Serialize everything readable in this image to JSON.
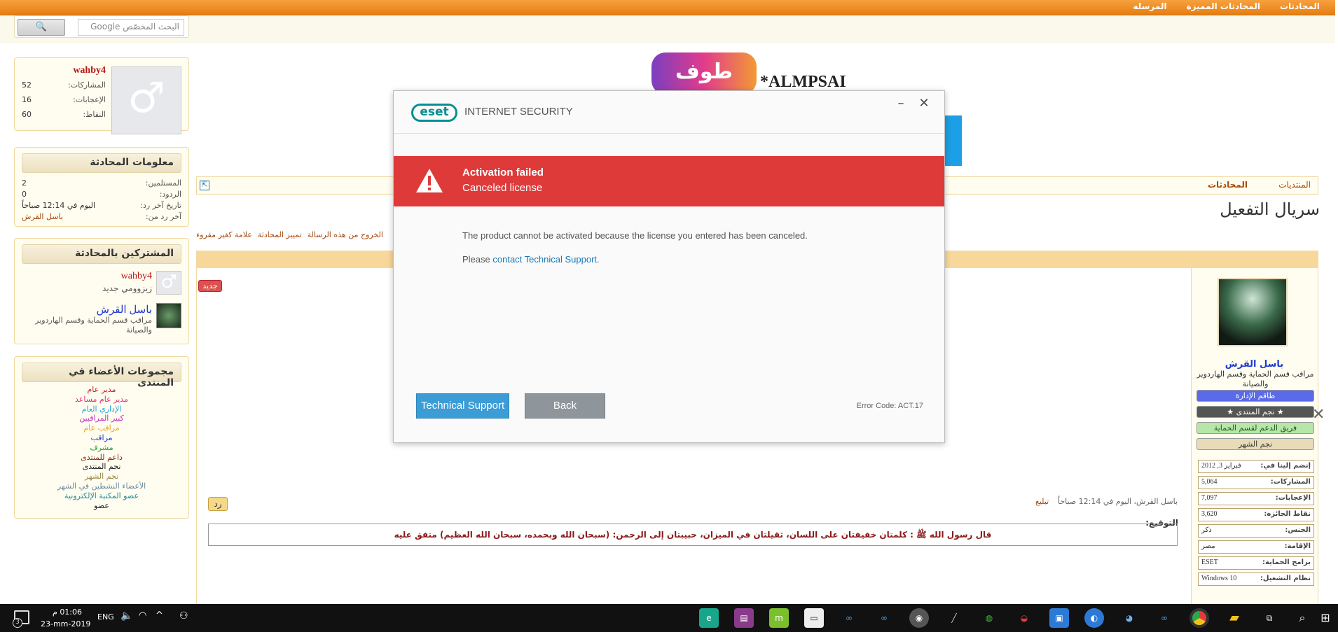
{
  "topnav": [
    "المحادثات",
    "المحادثات المميزة",
    "المرسله"
  ],
  "search": {
    "placeholder": "البحث المخصّص Google",
    "button": "🔍"
  },
  "header_logo": {
    "text": "طوف",
    "latin": "*ALMPSAI"
  },
  "user_panel": {
    "name": "wahby4",
    "rows": [
      {
        "label": "المشاركات:",
        "value": "52"
      },
      {
        "label": "الإعجابات:",
        "value": "16"
      },
      {
        "label": "النقاط:",
        "value": "60"
      }
    ]
  },
  "conv_info": {
    "title": "معلومات المحادثة",
    "rows": [
      {
        "label": "المستلمين:",
        "value": "2"
      },
      {
        "label": "الردود:",
        "value": "0"
      },
      {
        "label": "تاريخ آخر رد:",
        "value": "اليوم في 12:14 صباحاً"
      },
      {
        "label": "آخر رد من:",
        "value": "باسل القرش"
      }
    ]
  },
  "participants": {
    "title": "المشتركين بالمحادثة",
    "items": [
      {
        "name": "wahby4",
        "role": "زيزوومي جديد"
      },
      {
        "name": "باسل القرش",
        "role": "مراقب قسم الحماية وقسم الهاردوير والصيانة"
      }
    ]
  },
  "groups": {
    "title": "مجموعات الأعضاء في المنتدى",
    "items": [
      {
        "name": "مدير عام",
        "color": "#d21d1d"
      },
      {
        "name": "مدير عام مساعد",
        "color": "#e52c7c"
      },
      {
        "name": "الإداري العام",
        "color": "#1fa3e6"
      },
      {
        "name": "كبير المراقبين",
        "color": "#c12cc1"
      },
      {
        "name": "مراقب عام",
        "color": "#e6a51f"
      },
      {
        "name": "مراقب",
        "color": "#1d3ad2"
      },
      {
        "name": "مشرف",
        "color": "#2c9c2c"
      },
      {
        "name": "داعم للمنتدى",
        "color": "#8a2a0a"
      },
      {
        "name": "نجم المنتدى",
        "color": "#222222"
      },
      {
        "name": "نجم الشهر",
        "color": "#9a8a4a"
      },
      {
        "name": "الأعضاء النشطين في الشهر",
        "color": "#6a8aa0"
      },
      {
        "name": "عضو المكتبة الإلكترونية",
        "color": "#1f8a9c"
      },
      {
        "name": "عضو",
        "color": "#222222"
      }
    ]
  },
  "breadcrumb": [
    "المنتديات",
    "المحادثات"
  ],
  "page_title": "سريال التفعيل",
  "actions": [
    "الخروج من هذه الرسالة",
    "تمييز المحادثة",
    "علامة كغير مقروء"
  ],
  "new_badge": "جديد",
  "reply_btn": "رد",
  "post_meta": {
    "author_time": "باسل القرش، اليوم في 12:14 صباحاً",
    "report": "تبليغ"
  },
  "signature": {
    "label": "التوقيع:",
    "text": "قال رسول الله ﷺ : كلمتان خفيفتان على اللسان، ثقيلتان في الميزان، حبيبتان إلى الرحمن: (سبحان الله وبحمده، سبحان الله العظيم) متفق عليه"
  },
  "poster": {
    "name": "باسل القرش",
    "role": "مراقب قسم الحماية وقسم الهاردوير والصيانة",
    "badges": [
      {
        "text": "طاقم الإدارة",
        "bg": "#5a6ae8",
        "fg": "#ffffff"
      },
      {
        "text": "★ نجم المنتدى ★",
        "bg": "#555555",
        "fg": "#ffffff"
      },
      {
        "text": "فريق الدعم لقسم الحماية",
        "bg": "#b6e6a8",
        "fg": "#1c5a1c"
      },
      {
        "text": "نجم الشهر",
        "bg": "#e8dcb8",
        "fg": "#333333"
      }
    ],
    "info": [
      {
        "label": "إنضم إلينا في:",
        "value": "فبراير 3, 2012"
      },
      {
        "label": "المشاركات:",
        "value": "5,064"
      },
      {
        "label": "الإعجابات:",
        "value": "7,097"
      },
      {
        "label": "نقاط الجائزة:",
        "value": "3,620"
      },
      {
        "label": "الجنس:",
        "value": "ذكر"
      },
      {
        "label": "الإقامة:",
        "value": "مصر"
      },
      {
        "label": "برامج الحماية:",
        "value": "ESET"
      },
      {
        "label": "نظام التشغيل:",
        "value": "Windows 10"
      }
    ]
  },
  "modal": {
    "logo": "eset",
    "product": "INTERNET SECURITY",
    "alert_title": "Activation failed",
    "alert_sub": "Canceled license",
    "message": "The product cannot be activated because the license you entered has been canceled.",
    "please": "Please ",
    "link": "contact Technical Support",
    "period": ".",
    "btn_support": "Technical Support",
    "btn_back": "Back",
    "error_code": "Error Code: ACT.17"
  },
  "taskbar": {
    "time": "01:06 م",
    "date": "23-mm-2019",
    "lang": "ENG",
    "notif_count": "3"
  },
  "colors": {
    "orange": "#f29a35",
    "alert_red": "#de3a3a",
    "button_blue": "#3b9cd6"
  }
}
